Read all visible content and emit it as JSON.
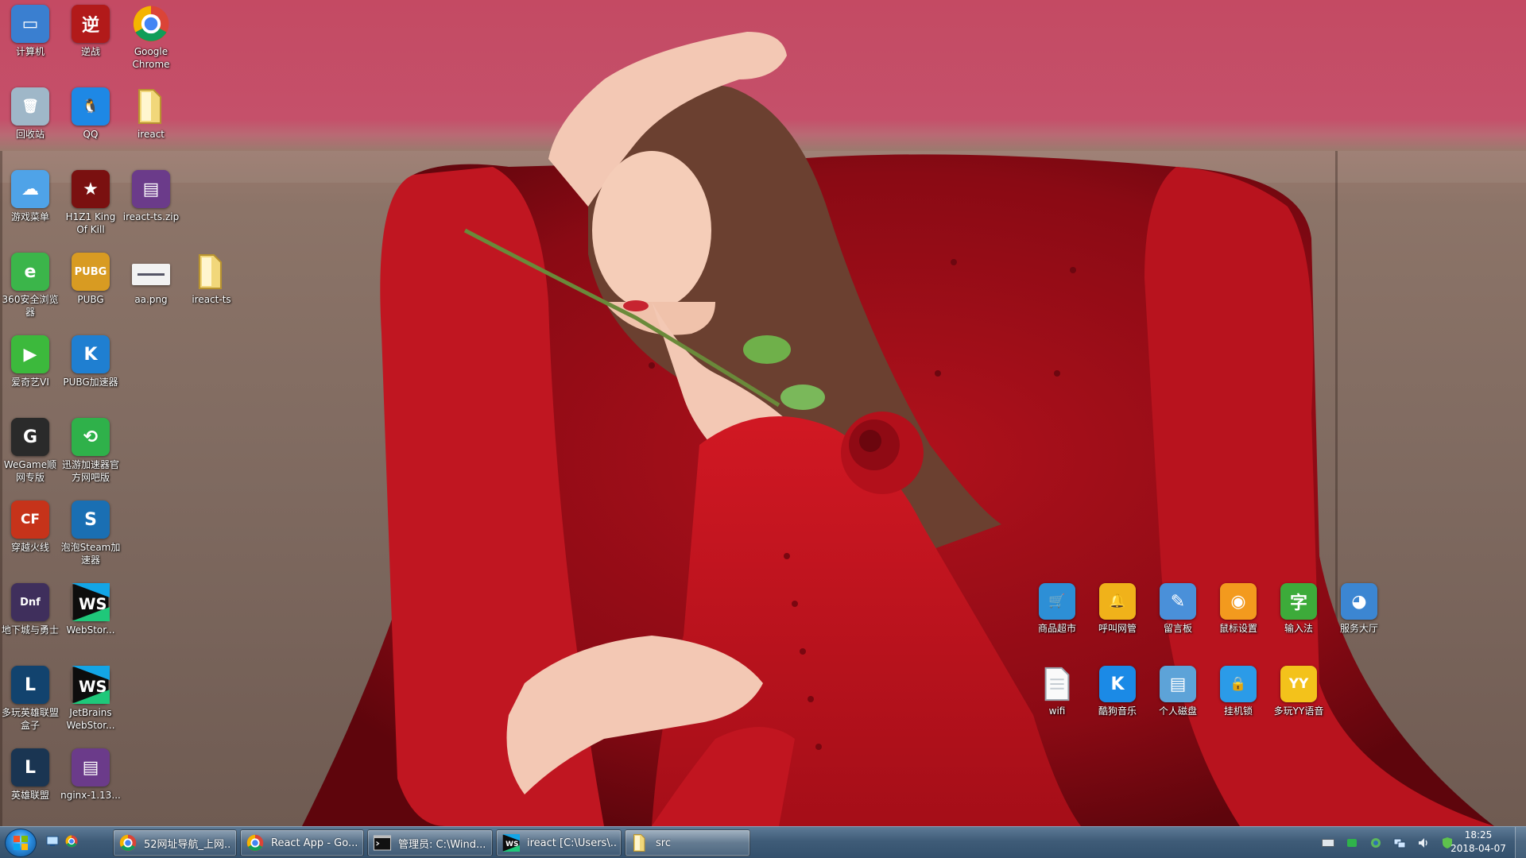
{
  "desktop_icons": [
    {
      "id": "computer",
      "label": "计算机",
      "icon": "computer-icon",
      "color": "#3a7fd0",
      "glyph": "▭"
    },
    {
      "id": "nizhan",
      "label": "逆战",
      "icon": "game-nizhan-icon",
      "color": "#b21a1a",
      "glyph": "逆"
    },
    {
      "id": "chrome",
      "label": "Google\nChrome",
      "icon": "chrome-icon",
      "color": "#ffffff",
      "glyph": ""
    },
    {
      "id": "recycle",
      "label": "回收站",
      "icon": "recycle-bin-icon",
      "color": "#9fb7c8",
      "glyph": "🗑"
    },
    {
      "id": "qq",
      "label": "QQ",
      "icon": "qq-penguin-icon",
      "color": "#1e88e5",
      "glyph": "🐧"
    },
    {
      "id": "ireact",
      "label": "ireact",
      "icon": "folder-icon",
      "color": "#e8c35a",
      "glyph": ""
    },
    {
      "id": "gamemenu",
      "label": "游戏菜单",
      "icon": "cloud-icon",
      "color": "#4fa3e8",
      "glyph": "☁"
    },
    {
      "id": "h1z1",
      "label": "H1Z1 King\nOf Kill",
      "icon": "h1z1-icon",
      "color": "#7a1010",
      "glyph": "★"
    },
    {
      "id": "ireactzip",
      "label": "ireact-ts.zip",
      "icon": "winrar-archive-icon",
      "color": "#6b3b8a",
      "glyph": "▤"
    },
    {
      "id": "360",
      "label": "360安全浏览\n器",
      "icon": "360-browser-icon",
      "color": "#3bb54a",
      "glyph": "e"
    },
    {
      "id": "pubg",
      "label": "PUBG",
      "icon": "pubg-icon",
      "color": "#d89b22",
      "glyph": "PUBG"
    },
    {
      "id": "aapng",
      "label": "aa.png",
      "icon": "image-file-icon",
      "color": "#f2f2f2",
      "glyph": "▬"
    },
    {
      "id": "ireactts",
      "label": "ireact-ts",
      "icon": "folder-icon",
      "color": "#e8c35a",
      "glyph": ""
    },
    {
      "id": "iqiyi",
      "label": "爱奇艺VI",
      "icon": "iqiyi-icon",
      "color": "#3cb93c",
      "glyph": "▶"
    },
    {
      "id": "pubgacc",
      "label": "PUBG加速器",
      "icon": "pubg-accelerator-icon",
      "color": "#1f7fd1",
      "glyph": "K"
    },
    {
      "id": "wegame",
      "label": "WeGame顺\n网专版",
      "icon": "wegame-icon",
      "color": "#2a2a2a",
      "glyph": "G"
    },
    {
      "id": "xunyou",
      "label": "迅游加速器官\n方网吧版",
      "icon": "xunyou-icon",
      "color": "#2fb14a",
      "glyph": "⟲"
    },
    {
      "id": "cf",
      "label": "穿越火线",
      "icon": "crossfire-icon",
      "color": "#c6331a",
      "glyph": "CF"
    },
    {
      "id": "paopao",
      "label": "泡泡Steam加\n速器",
      "icon": "paopao-steam-icon",
      "color": "#1a6fb3",
      "glyph": "S"
    },
    {
      "id": "dnf",
      "label": "地下城与勇士",
      "icon": "dnf-icon",
      "color": "#3f2f5c",
      "glyph": "Dnf"
    },
    {
      "id": "webstorm1",
      "label": "WebStor...",
      "icon": "webstorm-icon",
      "color": "#0f5c9e",
      "glyph": "WS"
    },
    {
      "id": "lolbox",
      "label": "多玩英雄联盟\n盒子",
      "icon": "lol-box-icon",
      "color": "#12436e",
      "glyph": "L"
    },
    {
      "id": "webstorm2",
      "label": "JetBrains\nWebStor...",
      "icon": "webstorm-icon",
      "color": "#0f5c9e",
      "glyph": "WS"
    },
    {
      "id": "lol",
      "label": "英雄联盟",
      "icon": "league-of-legends-icon",
      "color": "#1a3552",
      "glyph": "L"
    },
    {
      "id": "nginx",
      "label": "nginx-1.13...",
      "icon": "winrar-archive-icon",
      "color": "#6b3b8a",
      "glyph": "▤"
    }
  ],
  "right_icons": [
    {
      "id": "shop",
      "label": "商品超市",
      "icon": "shopping-cart-icon",
      "color": "#2d8fd6",
      "glyph": "🛒"
    },
    {
      "id": "call",
      "label": "呼叫网管",
      "icon": "bell-icon",
      "color": "#f0b21a",
      "glyph": "🔔"
    },
    {
      "id": "board",
      "label": "留言板",
      "icon": "message-board-icon",
      "color": "#4a90d9",
      "glyph": "✎"
    },
    {
      "id": "mouse",
      "label": "鼠标设置",
      "icon": "mouse-icon",
      "color": "#f39a1e",
      "glyph": "◉"
    },
    {
      "id": "ime",
      "label": "输入法",
      "icon": "input-method-icon",
      "color": "#3dab3a",
      "glyph": "字"
    },
    {
      "id": "service",
      "label": "服务大厅",
      "icon": "owl-service-icon",
      "color": "#3c86d2",
      "glyph": "◕"
    },
    {
      "id": "wifi",
      "label": "wifi",
      "icon": "text-file-icon",
      "color": "#f4f4f4",
      "glyph": ""
    },
    {
      "id": "kugou",
      "label": "酷狗音乐",
      "icon": "kugou-music-icon",
      "color": "#1b8ae6",
      "glyph": "K"
    },
    {
      "id": "disk",
      "label": "个人磁盘",
      "icon": "personal-disk-icon",
      "color": "#5da3d8",
      "glyph": "▤"
    },
    {
      "id": "lock",
      "label": "挂机锁",
      "icon": "lock-icon",
      "color": "#2b9be8",
      "glyph": "🔒"
    },
    {
      "id": "yy",
      "label": "多玩YY语音",
      "icon": "yy-voice-icon",
      "color": "#f3c21b",
      "glyph": "YY"
    }
  ],
  "taskbar": {
    "buttons": [
      {
        "label": "52网址导航_上网...",
        "icon": "chrome-icon",
        "active": false
      },
      {
        "label": "React App - Go...",
        "icon": "chrome-icon",
        "active": false
      },
      {
        "label": "管理员: C:\\Wind...",
        "icon": "cmd-icon",
        "active": false
      },
      {
        "label": "ireact [C:\\Users\\...",
        "icon": "webstorm-icon",
        "active": false
      },
      {
        "label": "src",
        "icon": "folder-icon",
        "active": true
      }
    ],
    "clock": {
      "time": "18:25",
      "date": "2018-04-07"
    }
  }
}
